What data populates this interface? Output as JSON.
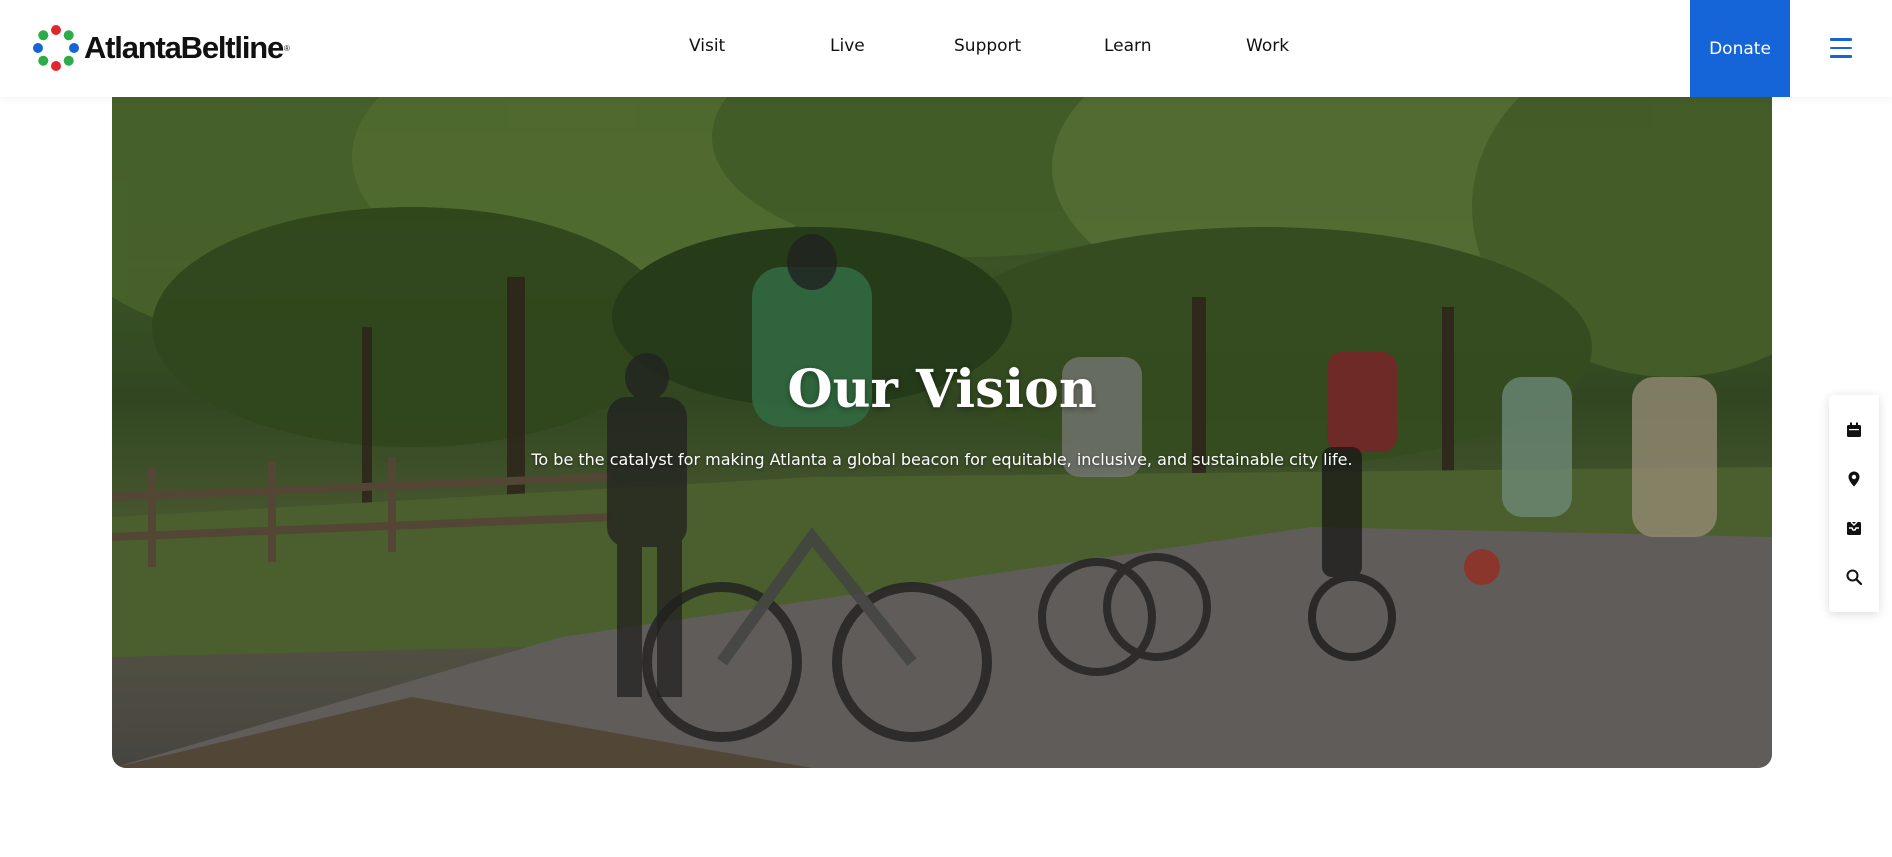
{
  "header": {
    "logo_text": "AtlantaBeltline",
    "logo_mark": "®",
    "nav": [
      {
        "label": "Visit"
      },
      {
        "label": "Live"
      },
      {
        "label": "Support"
      },
      {
        "label": "Learn"
      },
      {
        "label": "Work"
      }
    ],
    "donate_label": "Donate",
    "menu_icon": "hamburger-menu-icon"
  },
  "hero": {
    "title": "Our Vision",
    "subtitle": "To be the catalyst for making Atlanta a global beacon for equitable, inclusive, and sustainable city life."
  },
  "side_toolbar": {
    "items": [
      {
        "icon": "calendar-icon"
      },
      {
        "icon": "location-pin-icon"
      },
      {
        "icon": "inbox-icon"
      },
      {
        "icon": "search-icon"
      }
    ]
  },
  "colors": {
    "brand_blue": "#1565d8",
    "logo_red": "#e2262e",
    "logo_green": "#2bab4a",
    "logo_blue": "#1565d8"
  }
}
